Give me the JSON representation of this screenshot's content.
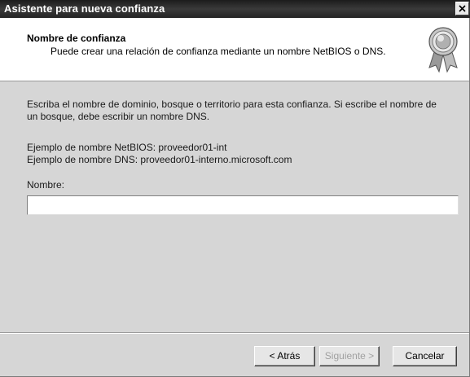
{
  "window": {
    "title": "Asistente para nueva confianza",
    "close_glyph": "×"
  },
  "header": {
    "title": "Nombre de confianza",
    "subtitle": "Puede crear una relación de confianza mediante un nombre NetBIOS o DNS.",
    "icon": "award-ribbon-icon"
  },
  "body": {
    "instruction_line1": "Escriba el nombre de dominio, bosque o territorio para esta confianza.  Si escribe el nombre de",
    "instruction_line2": "un bosque, debe escribir un nombre DNS.",
    "example_netbios": "Ejemplo de nombre NetBIOS: proveedor01-int",
    "example_dns": "Ejemplo de nombre DNS: proveedor01-interno.microsoft.com",
    "name_label": "Nombre:",
    "name_value": "",
    "name_placeholder": ""
  },
  "buttons": {
    "back": "< Atrás",
    "next": "Siguiente >",
    "cancel": "Cancelar"
  },
  "colors": {
    "titlebar": "#2a2a2a",
    "dialog_bg": "#d6d6d6",
    "header_bg": "#ffffff",
    "disabled_text": "#a0a0a0"
  }
}
